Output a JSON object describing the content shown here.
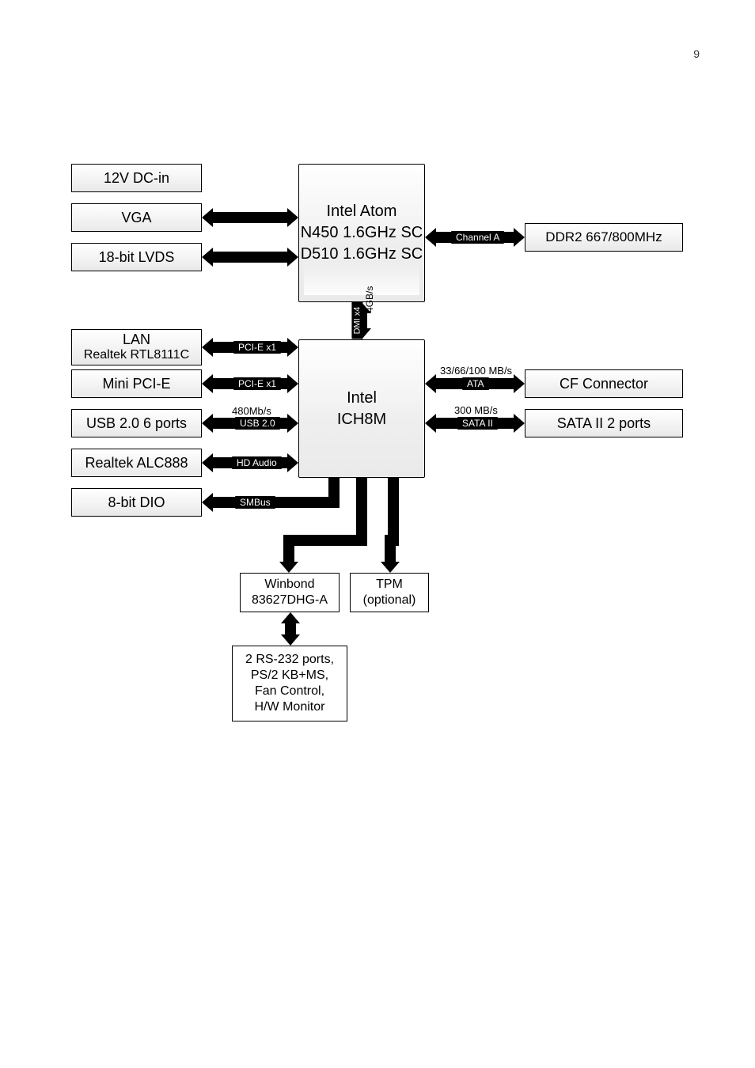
{
  "page_number": "9",
  "nodes": {
    "dc_in": "12V DC-in",
    "vga": "VGA",
    "lvds": "18-bit LVDS",
    "cpu_l1": "Intel Atom",
    "cpu_l2": "N450 1.6GHz SC",
    "cpu_l3": "D510 1.6GHz SC",
    "ddr2": "DDR2 667/800MHz",
    "lan_l1": "LAN",
    "lan_l2": "Realtek RTL8111C",
    "minipcie": "Mini PCI-E",
    "usb": "USB 2.0 6 ports",
    "alc888": "Realtek ALC888",
    "dio": "8-bit DIO",
    "ich8m_l1": "Intel",
    "ich8m_l2": "ICH8M",
    "cf": "CF Connector",
    "sata": "SATA II 2 ports",
    "winbond_l1": "Winbond",
    "winbond_l2": "83627DHG-A",
    "tpm_l1": "TPM",
    "tpm_l2": "(optional)",
    "rs232_l1": "2 RS-232 ports,",
    "rs232_l2": "PS/2 KB+MS,",
    "rs232_l3": "Fan Control,",
    "rs232_l4": "H/W Monitor"
  },
  "bus": {
    "channel_a": "Channel A",
    "dmi": "DMI x4",
    "dmi_rate": "4GB/s",
    "pcie_x1_a": "PCI-E x1",
    "pcie_x1_b": "PCI-E x1",
    "usb_rate": "480Mb/s",
    "usb_label": "USB 2.0",
    "hd_audio": "HD Audio",
    "smbus": "SMBus",
    "ata_rate": "33/66/100 MB/s",
    "ata_label": "ATA",
    "sata_rate": "300 MB/s",
    "sata_label": "SATA II"
  }
}
